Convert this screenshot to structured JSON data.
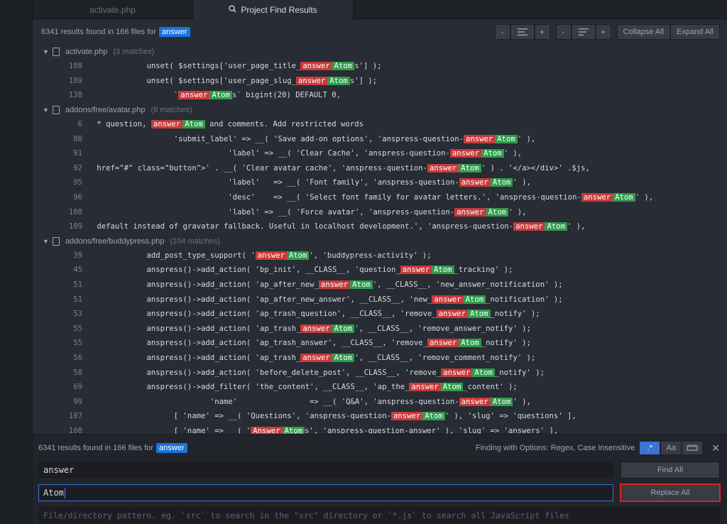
{
  "tabs": [
    {
      "label": "activate.php",
      "active": false
    },
    {
      "label": "Project Find Results",
      "active": true,
      "icon": "search-icon"
    }
  ],
  "results_header": {
    "summary": "6341 results found in 166 files for",
    "term": "answer",
    "collapse_all": "Collapse All",
    "expand_all": "Expand All"
  },
  "groups": [
    {
      "file": "activate.php",
      "count": "(3 matches)",
      "rows": [
        {
          "line": "108",
          "parts": [
            [
              "t",
              "            unset( $settings['user_page_title_"
            ],
            [
              "o",
              "answer"
            ],
            [
              "n",
              "Atom"
            ],
            [
              "t",
              "s'] );"
            ]
          ]
        },
        {
          "line": "109",
          "parts": [
            [
              "t",
              "            unset( $settings['user_page_slug_"
            ],
            [
              "o",
              "answer"
            ],
            [
              "n",
              "Atom"
            ],
            [
              "t",
              "s'] );"
            ]
          ]
        },
        {
          "line": "138",
          "parts": [
            [
              "t",
              "                  `"
            ],
            [
              "o",
              "answer"
            ],
            [
              "n",
              "Atom"
            ],
            [
              "t",
              "s` bigint(20) DEFAULT 0,"
            ]
          ]
        }
      ]
    },
    {
      "file": "addons/free/avatar.php",
      "count": "(8 matches)",
      "rows": [
        {
          "line": "6",
          "parts": [
            [
              "t",
              " * question, "
            ],
            [
              "o",
              "answer"
            ],
            [
              "n",
              "Atom"
            ],
            [
              "t",
              " and comments. Add restricted words"
            ]
          ]
        },
        {
          "line": "88",
          "parts": [
            [
              "t",
              "                  'submit_label' => __( 'Save add-on options', 'anspress-question-"
            ],
            [
              "o",
              "answer"
            ],
            [
              "n",
              "Atom"
            ],
            [
              "t",
              "' ),"
            ]
          ]
        },
        {
          "line": "91",
          "parts": [
            [
              "t",
              "                              'label' => __( 'Clear Cache', 'anspress-question-"
            ],
            [
              "o",
              "answer"
            ],
            [
              "n",
              "Atom"
            ],
            [
              "t",
              "' ),"
            ]
          ]
        },
        {
          "line": "92",
          "parts": [
            [
              "t",
              " href=\"#\" class=\"button\">' . __( 'Clear avatar cache', 'anspress-question-"
            ],
            [
              "o",
              "answer"
            ],
            [
              "n",
              "Atom"
            ],
            [
              "t",
              "' ) . '</a></div>' .$js,"
            ]
          ]
        },
        {
          "line": "95",
          "parts": [
            [
              "t",
              "                              'label'   => __( 'Font family', 'anspress-question-"
            ],
            [
              "o",
              "answer"
            ],
            [
              "n",
              "Atom"
            ],
            [
              "t",
              "' ),"
            ]
          ]
        },
        {
          "line": "96",
          "parts": [
            [
              "t",
              "                              'desc'    => __( 'Select font family for avatar letters.', 'anspress-question-"
            ],
            [
              "o",
              "answer"
            ],
            [
              "n",
              "Atom"
            ],
            [
              "t",
              "' ),"
            ]
          ]
        },
        {
          "line": "108",
          "parts": [
            [
              "t",
              "                              'label' => __( 'Force avatar', 'anspress-question-"
            ],
            [
              "o",
              "answer"
            ],
            [
              "n",
              "Atom"
            ],
            [
              "t",
              "' ),"
            ]
          ]
        },
        {
          "line": "109",
          "parts": [
            [
              "t",
              " default instead of gravatar fallback. Useful in localhost development.', 'anspress-question-"
            ],
            [
              "o",
              "answer"
            ],
            [
              "n",
              "Atom"
            ],
            [
              "t",
              "' ),"
            ]
          ]
        }
      ]
    },
    {
      "file": "addons/free/buddypress.php",
      "count": "(104 matches)",
      "rows": [
        {
          "line": "39",
          "parts": [
            [
              "t",
              "            add_post_type_support( '"
            ],
            [
              "o",
              "answer"
            ],
            [
              "n",
              "Atom"
            ],
            [
              "t",
              "', 'buddypress-activity' );"
            ]
          ]
        },
        {
          "line": "45",
          "parts": [
            [
              "t",
              "            anspress()->add_action( 'bp_init', __CLASS__, 'question_"
            ],
            [
              "o",
              "answer"
            ],
            [
              "n",
              "Atom"
            ],
            [
              "t",
              "_tracking' );"
            ]
          ]
        },
        {
          "line": "51",
          "parts": [
            [
              "t",
              "            anspress()->add_action( 'ap_after_new_"
            ],
            [
              "o",
              "answer"
            ],
            [
              "n",
              "Atom"
            ],
            [
              "t",
              "', __CLASS__, 'new_answer_notification' );"
            ]
          ]
        },
        {
          "line": "51",
          "parts": [
            [
              "t",
              "            anspress()->add_action( 'ap_after_new_answer', __CLASS__, 'new_"
            ],
            [
              "o",
              "answer"
            ],
            [
              "n",
              "Atom"
            ],
            [
              "t",
              "_notification' );"
            ]
          ]
        },
        {
          "line": "53",
          "parts": [
            [
              "t",
              "            anspress()->add_action( 'ap_trash_question', __CLASS__, 'remove_"
            ],
            [
              "o",
              "answer"
            ],
            [
              "n",
              "Atom"
            ],
            [
              "t",
              "_notify' );"
            ]
          ]
        },
        {
          "line": "55",
          "parts": [
            [
              "t",
              "            anspress()->add_action( 'ap_trash_"
            ],
            [
              "o",
              "answer"
            ],
            [
              "n",
              "Atom"
            ],
            [
              "t",
              "', __CLASS__, 'remove_answer_notify' );"
            ]
          ]
        },
        {
          "line": "55",
          "parts": [
            [
              "t",
              "            anspress()->add_action( 'ap_trash_answer', __CLASS__, 'remove_"
            ],
            [
              "o",
              "answer"
            ],
            [
              "n",
              "Atom"
            ],
            [
              "t",
              "_notify' );"
            ]
          ]
        },
        {
          "line": "56",
          "parts": [
            [
              "t",
              "            anspress()->add_action( 'ap_trash_"
            ],
            [
              "o",
              "answer"
            ],
            [
              "n",
              "Atom"
            ],
            [
              "t",
              "', __CLASS__, 'remove_comment_notify' );"
            ]
          ]
        },
        {
          "line": "58",
          "parts": [
            [
              "t",
              "            anspress()->add_action( 'before_delete_post', __CLASS__, 'remove_"
            ],
            [
              "o",
              "answer"
            ],
            [
              "n",
              "Atom"
            ],
            [
              "t",
              "_notify' );"
            ]
          ]
        },
        {
          "line": "69",
          "parts": [
            [
              "t",
              "            anspress()->add_filter( 'the_content', __CLASS__, 'ap_the_"
            ],
            [
              "o",
              "answer"
            ],
            [
              "n",
              "Atom"
            ],
            [
              "t",
              "_content' );"
            ]
          ]
        },
        {
          "line": "99",
          "parts": [
            [
              "t",
              "                          'name'                => __( 'Q&A', 'anspress-question-"
            ],
            [
              "o",
              "answer"
            ],
            [
              "n",
              "Atom"
            ],
            [
              "t",
              "' ),"
            ]
          ]
        },
        {
          "line": "107",
          "parts": [
            [
              "t",
              "                  [ 'name' => __( 'Questions', 'anspress-question-"
            ],
            [
              "o",
              "answer"
            ],
            [
              "n",
              "Atom"
            ],
            [
              "t",
              "' ), 'slug' => 'questions' ],"
            ]
          ]
        },
        {
          "line": "108",
          "parts": [
            [
              "t",
              "                  [ 'name' => __( '"
            ],
            [
              "o",
              "Answer"
            ],
            [
              "n",
              "Atom"
            ],
            [
              "t",
              "s', 'anspress-question-answer' ), 'slug' => 'answers' ],"
            ]
          ]
        }
      ]
    }
  ],
  "find_panel": {
    "summary": "6341 results found in 166 files for",
    "term": "answer",
    "options_label": "Finding with Options:",
    "options_value": "Regex, Case Insensitive",
    "opt_regex": ".*",
    "opt_case": "Aa",
    "find_value": "answer",
    "replace_value": "Atom",
    "pattern_placeholder": "File/directory pattern. eg. `src` to search in the \"src\" directory or `*.js` to search all JavaScript files",
    "find_all": "Find All",
    "replace_all": "Replace All"
  },
  "colors": {
    "accent": "#3b74d6",
    "match_old": "#c83a3a",
    "match_new": "#2e9b4c",
    "highlight_box": "#e02020"
  }
}
